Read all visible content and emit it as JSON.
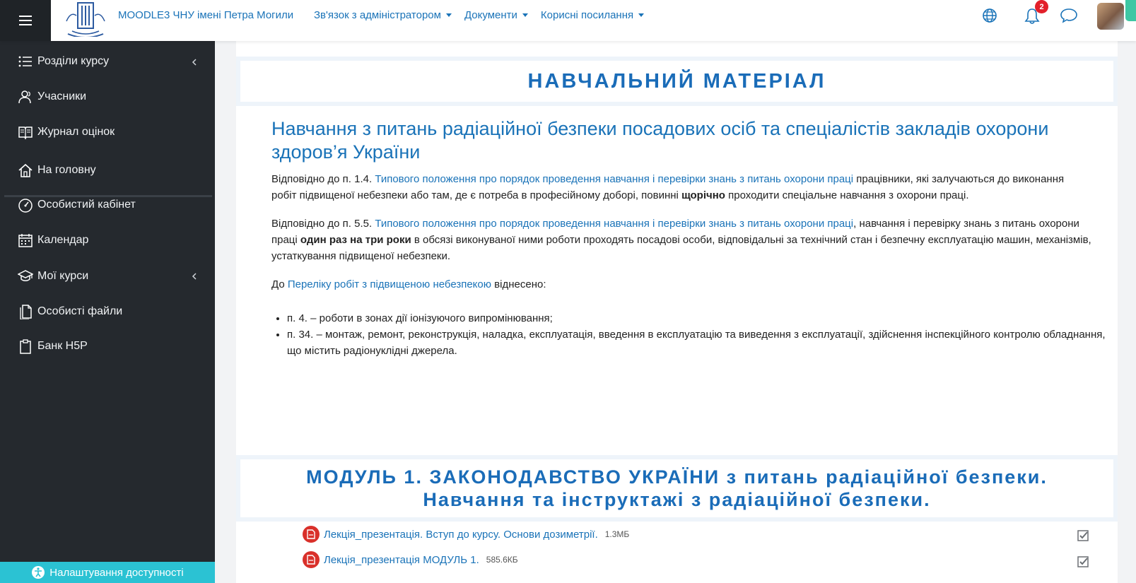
{
  "navbar": {
    "brand": "MOODLE3 ЧНУ імені Петра Могили",
    "menu": [
      {
        "label": "Зв'язок з адміністратором"
      },
      {
        "label": "Документи"
      },
      {
        "label": "Корисні посилання"
      }
    ],
    "notification_count": "2"
  },
  "sidebar": {
    "items": [
      {
        "label": "Розділи курсу",
        "icon": "list-icon"
      },
      {
        "label": "Учасники",
        "icon": "users-icon"
      },
      {
        "label": "Журнал оцінок",
        "icon": "book-icon"
      },
      {
        "label": "На головну",
        "icon": "home-icon"
      },
      {
        "label": "Особистий кабінет",
        "icon": "dashboard-icon"
      },
      {
        "label": "Календар",
        "icon": "calendar-icon"
      },
      {
        "label": "Мої курси",
        "icon": "graduation-cap-icon"
      },
      {
        "label": "Особисті файли",
        "icon": "files-icon"
      },
      {
        "label": "Банк H5P",
        "icon": "clipboard-icon"
      }
    ],
    "accessibility_label": "Налаштування доступності"
  },
  "content": {
    "section_title": "НАВЧАЛЬНИЙ МАТЕРІАЛ",
    "course_heading": "Навчання з питань радіаційної безпеки посадових осіб та спеціалістів закладів охорони здоров’я України",
    "para1": {
      "t1": "Відповідно до п. 1.4. ",
      "link": "Типового положення про порядок проведення навчання і перевірки знань з питань охорони праці",
      "t2": " працівники, які залучаються до виконання робіт підвищеної небезпеки або там, де є потреба в професійному доборі, повинні ",
      "bold": "щорічно",
      "t3": " проходити спеціальне навчання з охорони праці."
    },
    "para2": {
      "t1": "Відповідно до п. 5.5. ",
      "link": "Типового положення про порядок проведення навчання і перевірки знань з питань охорони праці",
      "t2": ", навчання і перевірку знань з питань охорони праці ",
      "bold": "один раз на три роки",
      "t3": " в обсязі виконуваної ними роботи проходять посадові особи, відповідальні за технічний стан і безпечну експлуатацію машин, механізмів, устаткування підвищеної небезпеки."
    },
    "para3": {
      "t1": "До ",
      "link": "Переліку робіт з підвищеною небезпекою",
      "t2": " віднесено:"
    },
    "list": [
      "п. 4. – роботи в зонах дії іонізуючого випромінювання;",
      "п. 34. – монтаж, ремонт, реконструкція, наладка, експлуатація, введення в експлуатацію та виведення з експлуатації, здійснення інспекційного контролю обладнання, що містить радіонуклідні джерела."
    ],
    "module_title_line1": "МОДУЛЬ 1. ЗАКОНОДАВСТВО УКРАЇНИ з питань радіаційної безпеки.",
    "module_title_line2": "Навчання та інструктажі з радіаційної безпеки.",
    "activities": [
      {
        "label": "Лекція_презентація. Вступ до курсу. Основи дозиметрії.",
        "size": "1.3МБ"
      },
      {
        "label": "Лекція_презентація МОДУЛЬ 1.",
        "size": "585.6КБ"
      }
    ]
  },
  "colors": {
    "accent": "#1a73b8",
    "sidebar_bg": "#25292e",
    "accessibility_bg": "#2bc2d3",
    "pdf_icon": "#d9302a",
    "badge": "#e2202a"
  }
}
